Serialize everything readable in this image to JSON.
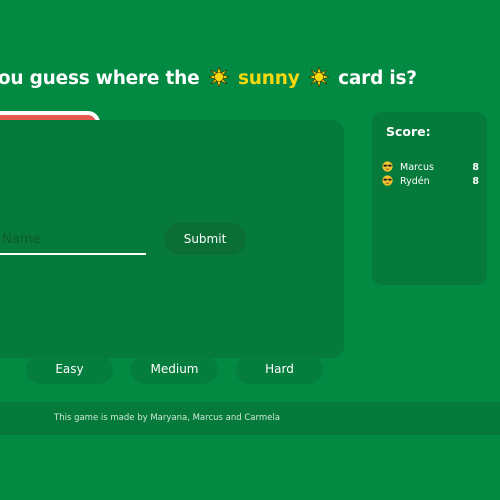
{
  "heading": {
    "prefix": "you guess where the",
    "highlight": "sunny",
    "suffix": "card is?",
    "highlight_color": "#f6d90c",
    "icon": "sun-icon"
  },
  "game": {
    "name_placeholder": "Name",
    "submit_label": "Submit"
  },
  "score": {
    "title": "Score:",
    "players": [
      {
        "name": "Marcus",
        "points": "8",
        "icon": "sunglasses-face-icon"
      },
      {
        "name": "Rydén",
        "points": "8",
        "icon": "sunglasses-face-icon"
      }
    ]
  },
  "difficulty": {
    "easy": "Easy",
    "medium": "Medium",
    "hard": "Hard"
  },
  "footer": {
    "text": "This game is made by Maryana, Marcus and Carmela"
  },
  "colors": {
    "background": "#028a43",
    "panel": "#067a3a",
    "button": "#0a6e35",
    "card": "#e65a4f",
    "accent": "#f6d90c"
  }
}
